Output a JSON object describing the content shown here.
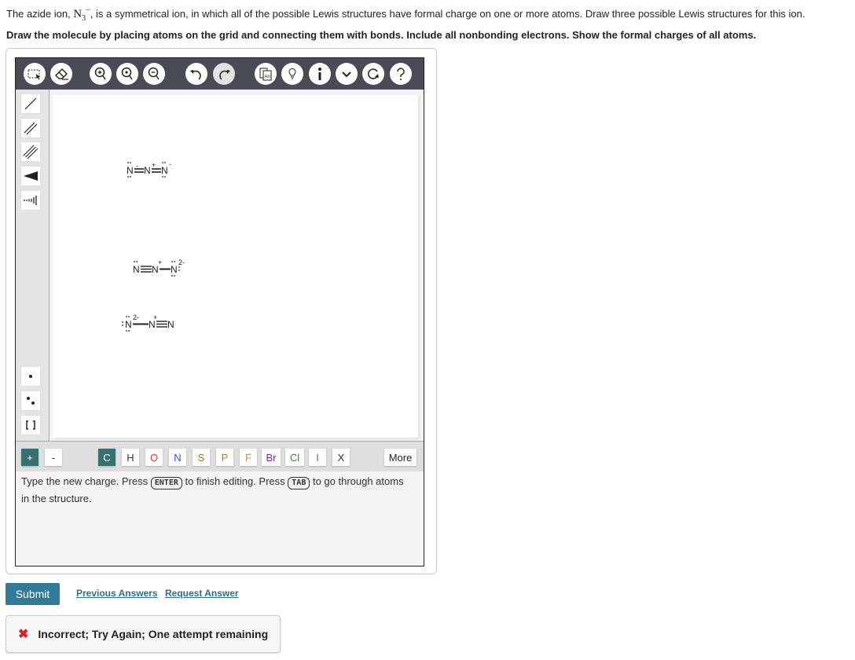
{
  "question": {
    "line1_prefix": "The azide ion, ",
    "formula_base": "N",
    "formula_sub": "3",
    "formula_sup": "−",
    "line1_suffix": ", is a symmetrical ion, in which all of the possible Lewis structures have formal charge on one or more atoms. Draw three possible Lewis structures for this ion.",
    "line2": "Draw the molecule by placing atoms on the grid and connecting them with bonds. Include all nonbonding electrons. Show the formal charges of all atoms."
  },
  "toolbar": {
    "buttons": [
      "select-tool",
      "eraser-tool",
      "zoom-in",
      "zoom-reset",
      "zoom-out",
      "undo",
      "redo",
      "templates",
      "hint",
      "info",
      "more-options",
      "reset",
      "help"
    ]
  },
  "left_tools": [
    "single-bond",
    "double-bond",
    "triple-bond",
    "wedge-bond",
    "hash-bond",
    "radical",
    "lone-pair",
    "brackets"
  ],
  "canvas": {
    "structures": [
      {
        "atoms": [
          "N",
          "N",
          "N"
        ],
        "bonds": [
          "double",
          "double"
        ],
        "charges": [
          "-",
          "+",
          "-"
        ]
      },
      {
        "atoms": [
          "N",
          "N",
          "N"
        ],
        "bonds": [
          "triple",
          "single"
        ],
        "charges": [
          "",
          "+",
          "2-"
        ]
      },
      {
        "atoms": [
          "N",
          "N",
          "N"
        ],
        "bonds": [
          "single",
          "triple"
        ],
        "charges": [
          "2-",
          "+",
          ""
        ]
      }
    ]
  },
  "atom_bar": {
    "plus": "+",
    "minus": "-",
    "atoms": [
      {
        "label": "C",
        "color": "#ffffff"
      },
      {
        "label": "H",
        "color": "#333333"
      },
      {
        "label": "O",
        "color": "#e53935"
      },
      {
        "label": "N",
        "color": "#3050e0"
      },
      {
        "label": "S",
        "color": "#9a7a2a"
      },
      {
        "label": "P",
        "color": "#c8781c"
      },
      {
        "label": "F",
        "color": "#c89040"
      },
      {
        "label": "Br",
        "color": "#7a2a9a"
      },
      {
        "label": "Cl",
        "color": "#3a8a2a"
      },
      {
        "label": "I",
        "color": "#9a4ab0"
      },
      {
        "label": "X",
        "color": "#333333"
      }
    ],
    "more": "More"
  },
  "hint": {
    "part1": "Type the new charge. Press ",
    "key1": "ENTER",
    "part2": " to finish editing. Press ",
    "key2": "TAB",
    "part3": " to go through atoms in the structure."
  },
  "actions": {
    "submit": "Submit",
    "previous_answers": "Previous Answers",
    "request_answer": "Request Answer"
  },
  "feedback": {
    "icon": "✖",
    "message": "Incorrect; Try Again; One attempt remaining"
  }
}
